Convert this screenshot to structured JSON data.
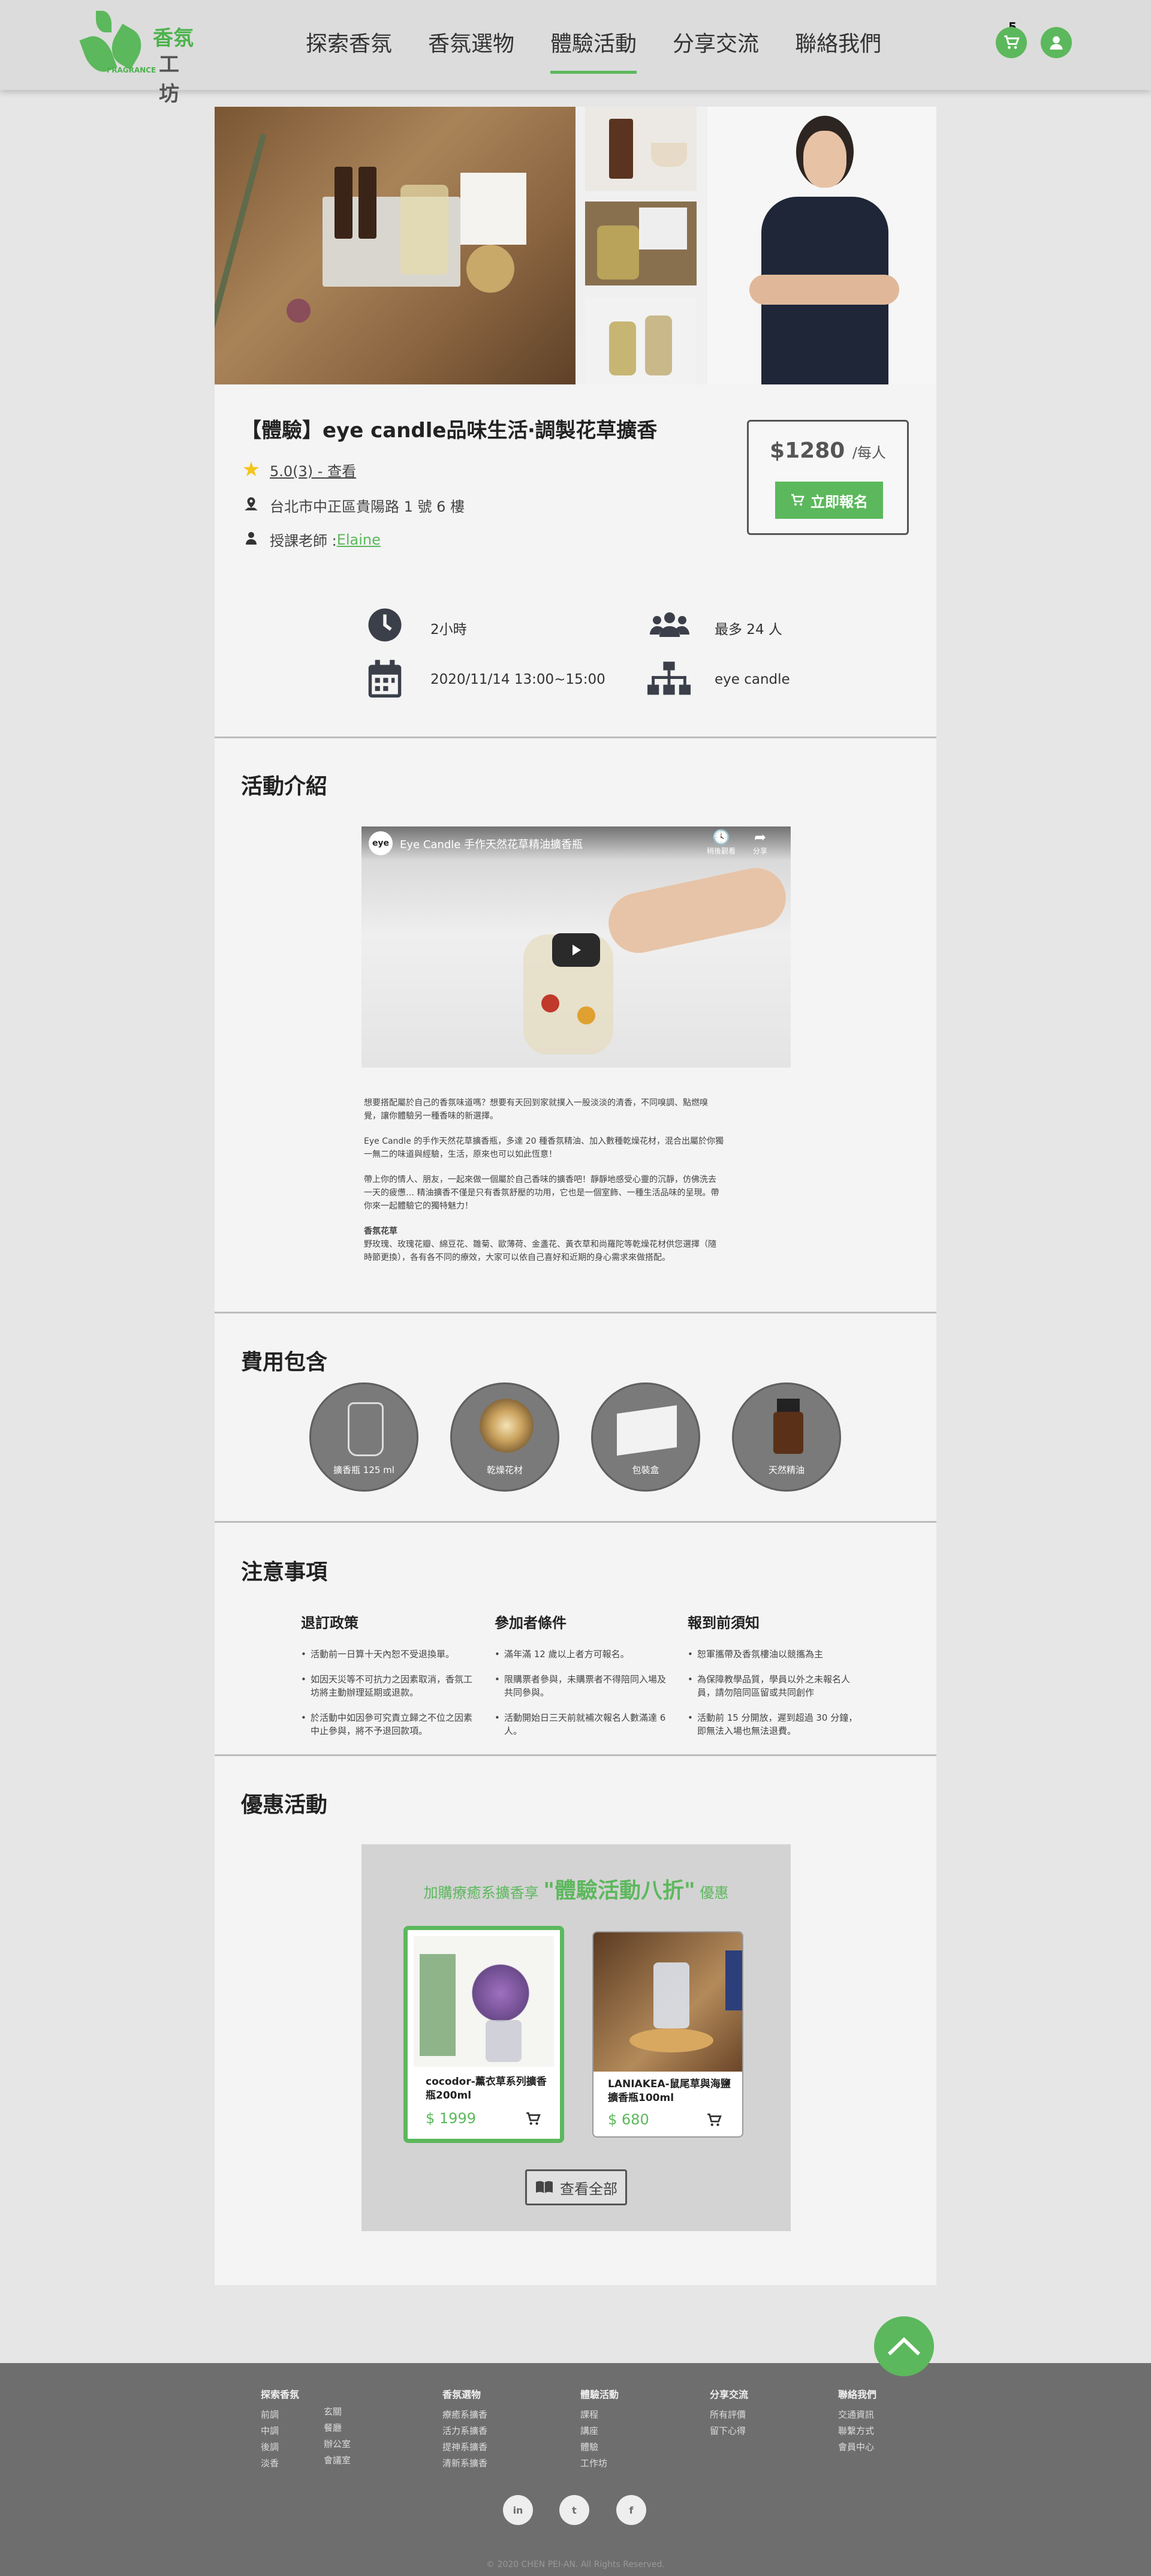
{
  "header": {
    "logo_text_1": "香氛",
    "logo_text_2": "工坊",
    "logo_small": "FRAGRANCE",
    "nav": [
      {
        "label": "探索香氛"
      },
      {
        "label": "香氛選物"
      },
      {
        "label": "體驗活動"
      },
      {
        "label": "分享交流"
      },
      {
        "label": "聯絡我們"
      }
    ],
    "cart_count": "5"
  },
  "course": {
    "title": "【體驗】eye candle品味生活‧調製花草擴香",
    "rating": "5.0(3) - 查看",
    "address": "台北市中正區貴陽路 1 號 6 樓",
    "teacher_label": "授課老師 : ",
    "teacher_name": "Elaine",
    "price": "$1280",
    "price_unit": "/每人",
    "apply_label": "立即報名"
  },
  "info": {
    "duration": "2小時",
    "capacity": "最多 24 人",
    "datetime": "2020/11/14 13:00~15:00",
    "organizer": "eye candle"
  },
  "intro": {
    "title": "活動介紹",
    "video_title": "Eye Candle 手作天然花草精油擴香瓶",
    "video_watch_later": "稍後觀看",
    "video_share": "分享",
    "paragraphs": [
      "想要搭配屬於自己的香氛味道嗎？想要有天回到家就撲入一股淡淡的清香，不同嗅調、點燃嗅覺，讓你體驗另一種香味的新選擇。",
      "Eye Candle 的手作天然花草擴香瓶，多達 20 種香氛精油、加入數種乾燥花材，混合出屬於你獨一無二的味道與經驗，生活，原來也可以如此恆意！",
      "帶上你的情人、朋友，一起來做一個屬於自己香味的擴香吧！靜靜地感受心靈的沉靜，仿佛洗去一天的疲憊… 精油擴香不僅是只有香氛舒壓的功用，它也是一個室飾、一種生活品味的呈現。帶你來一起體驗它的獨特魅力！"
    ],
    "sub_title": "香氛花草",
    "sub_text": "野玫瑰、玫瑰花瓣、綿豆花、雛菊、歐薄荷、金盞花、黃衣草和尚羅陀等乾燥花材供您選擇（隨時節更換），各有各不同的療效，大家可以依自己喜好和近期的身心需求來做搭配。"
  },
  "fees": {
    "title": "費用包含",
    "items": [
      {
        "label": "擴香瓶 125 ml"
      },
      {
        "label": "乾燥花材"
      },
      {
        "label": "包裝盒"
      },
      {
        "label": "天然精油"
      }
    ]
  },
  "notes": {
    "title": "注意事項",
    "columns": [
      {
        "heading": "退訂政策",
        "items": [
          "活動前一日算十天內恕不受退換單。",
          "如因天災等不可抗力之因素取消，香氛工坊將主動辦理延期或退款。",
          "於活動中如因參可究責立歸之不位之因素中止參與，將不予退回款項。"
        ]
      },
      {
        "heading": "參加者條件",
        "items": [
          "滿年滿 12 歲以上者方可報名。",
          "限購票者參與，未購票者不得陪同入場及共同參與。",
          "活動開始日三天前就補次報名人數滿達 6 人。"
        ]
      },
      {
        "heading": "報到前須知",
        "items": [
          "恕軍攜帶及香氛樓油以競攜為主",
          "為保障教學品質，學員以外之未報名人員，請勿陪同區留或共同創作",
          "活動前 15 分開放，遲到超過 30 分鐘，即無法入場也無法退費。"
        ]
      }
    ]
  },
  "promo": {
    "title": "優惠活動",
    "banner_prefix": "加購療癒系擴香享 ",
    "banner_highlight": "\"體驗活動八折\"",
    "banner_suffix": " 優惠",
    "products": [
      {
        "name": "cocodor-薰衣草系列擴香瓶200ml",
        "price": "$ 1999"
      },
      {
        "name": "LANIAKEA-鼠尾草與海鹽擴香瓶100ml",
        "price": "$ 680"
      }
    ],
    "view_all": "查看全部"
  },
  "footer": {
    "columns": [
      {
        "heading": "探索香氛",
        "links": [
          "前調",
          "中調",
          "後調",
          "淡香"
        ]
      },
      {
        "heading": "",
        "links": [
          "玄關",
          "餐廳",
          "辦公室",
          "會議室"
        ]
      },
      {
        "heading": "香氛選物",
        "links": [
          "療癒系擴香",
          "活力系擴香",
          "提神系擴香",
          "清新系擴香"
        ]
      },
      {
        "heading": "體驗活動",
        "links": [
          "課程",
          "講座",
          "體驗",
          "工作坊"
        ]
      },
      {
        "heading": "分享交流",
        "links": [
          "所有評價",
          "留下心得"
        ]
      },
      {
        "heading": "聯絡我們",
        "links": [
          "交通資訊",
          "聯繫方式",
          "會員中心"
        ]
      }
    ],
    "social": [
      "in",
      "t",
      "f"
    ],
    "copyright": "© 2020 CHEN PEI-AN. All Rights Reserved."
  },
  "colors": {
    "accent": "#5cb85c",
    "footer": "#6e6e6e",
    "page": "#e6e6e6"
  }
}
